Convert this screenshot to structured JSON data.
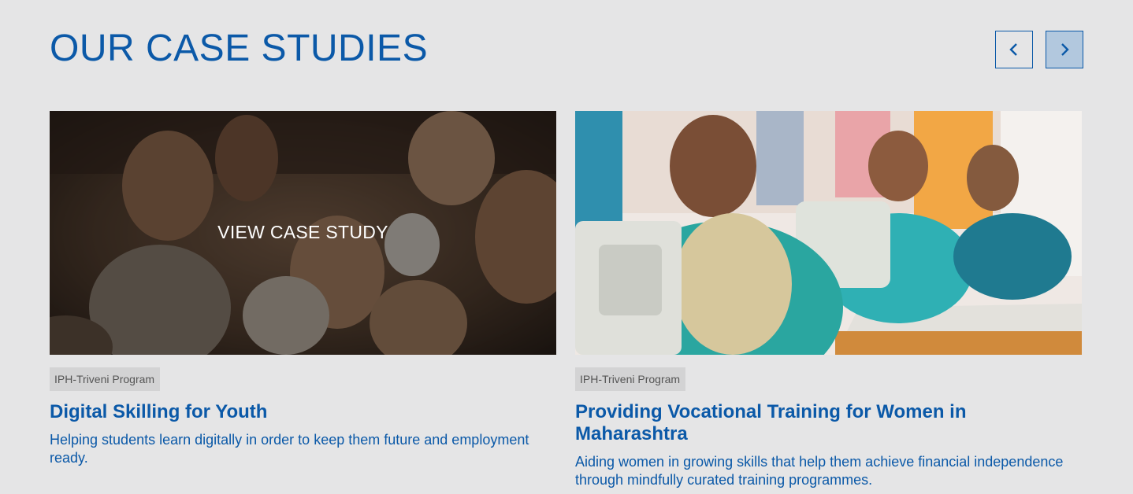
{
  "header": {
    "title": "OUR CASE STUDIES",
    "prev_icon": "chevron-left-icon",
    "next_icon": "chevron-right-icon"
  },
  "colors": {
    "accent": "#0b59a8",
    "background": "#e5e5e6",
    "tag_bg": "#d3d3d4",
    "next_btn_bg": "#b2c8de"
  },
  "cards": [
    {
      "overlay_label": "VIEW CASE STUDY",
      "tag": "IPH-Triveni Program",
      "title": "Digital Skilling for Youth",
      "description": "Helping students learn digitally in order to keep them future and employment ready.",
      "image": "children-smiling-photo"
    },
    {
      "tag": "IPH-Triveni Program",
      "title": "Providing Vocational Training for Women in Maharashtra",
      "description": "Aiding women in growing skills that help them achieve financial independence through mindfully curated training programmes.",
      "image": "women-sewing-photo"
    }
  ]
}
